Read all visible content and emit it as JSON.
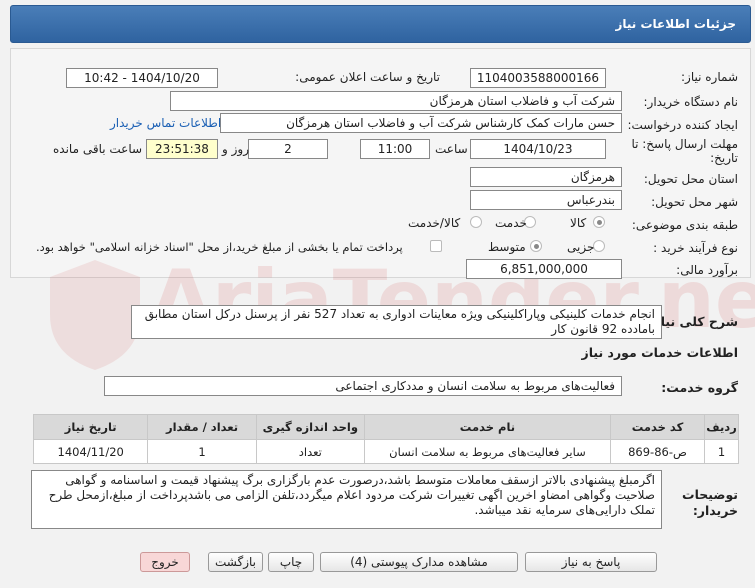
{
  "header": {
    "title": "جزئیات اطلاعات نیاز"
  },
  "fields": {
    "need_number_label": "شماره نیاز:",
    "need_number": "1104003588000166",
    "announce_label": "تاریخ و ساعت اعلان عمومی:",
    "announce_value": "1404/10/20 - 10:42",
    "buyer_label": "نام دستگاه خریدار:",
    "buyer_value": "شرکت آب و فاضلاب استان هرمزگان",
    "creator_label": "ایجاد کننده درخواست:",
    "creator_value": "حسن مارات کمک کارشناس شرکت آب و فاضلاب استان هرمزگان",
    "contact_link": "اطلاعات تماس خریدار",
    "deadline_label_1": "مهلت ارسال پاسخ: تا",
    "deadline_label_2": "تاریخ:",
    "deadline_date": "1404/10/23",
    "time_label": "ساعت",
    "deadline_time": "11:00",
    "days_value": "2",
    "days_label": "روز و",
    "remaining_time": "23:51:38",
    "remaining_label": "ساعت باقی مانده",
    "province_label": "استان محل تحویل:",
    "province_value": "هرمزگان",
    "city_label": "شهر محل تحویل:",
    "city_value": "بندرعباس",
    "category_label": "طبقه بندی موضوعی:",
    "category_options": [
      "کالا",
      "خدمت",
      "کالا/خدمت"
    ],
    "process_label": "نوع فرآیند خرید :",
    "process_options": [
      "جزیی",
      "متوسط"
    ],
    "payment_note": "پرداخت تمام یا بخشی از مبلغ خرید،از محل \"اسناد خزانه اسلامی\" خواهد بود.",
    "budget_label": "برآورد مالی:",
    "budget_value": "6,851,000,000"
  },
  "description": {
    "label": "شرح کلی نیاز:",
    "text": "انجام خدمات کلینیکی وپاراکلینیکی ویژه معاینات ادواری به تعداد 527 نفر از پرسنل درکل استان مطابق بامادده 92 قانون کار"
  },
  "services": {
    "section_title": "اطلاعات خدمات مورد نیاز",
    "group_label": "گروه خدمت:",
    "group_value": "فعالیت‌های مربوط به سلامت انسان و مددکاری اجتماعی",
    "columns": [
      "ردیف",
      "کد خدمت",
      "نام خدمت",
      "واحد اندازه گیری",
      "تعداد / مقدار",
      "تاریخ نیاز"
    ],
    "rows": [
      {
        "row": "1",
        "code": "ص-86-869",
        "name": "سایر فعالیت‌های مربوط به سلامت انسان",
        "unit": "تعداد",
        "qty": "1",
        "date": "1404/11/20"
      }
    ]
  },
  "buyer_notes": {
    "label_1": "توضیحات",
    "label_2": "خریدار:",
    "text": "اگرمبلغ پیشنهادی بالاتر ازسقف معاملات متوسط باشد،درصورت عدم بارگزاری برگ پیشنهاد قیمت و اساسنامه و گواهی صلاحیت وگواهی امضاو اخرین اگهی تغییرات شرکت مردود اعلام میگردد،تلفن الزامی می باشدپرداخت از مبلغ،ازمحل طرح تملک دارایی‌های سرمایه نقد میباشد."
  },
  "buttons": {
    "reply": "پاسخ به نیاز",
    "attachments": "مشاهده مدارک پیوستی (4)",
    "print": "چاپ",
    "back": "بازگشت",
    "exit": "خروج"
  },
  "watermark": "AriaTender.net",
  "colors": {
    "header": "#2f63a0",
    "link": "#1a5fb4",
    "remaining_bg": "#ffffcc",
    "exit_bg": "#f8d7d7"
  }
}
